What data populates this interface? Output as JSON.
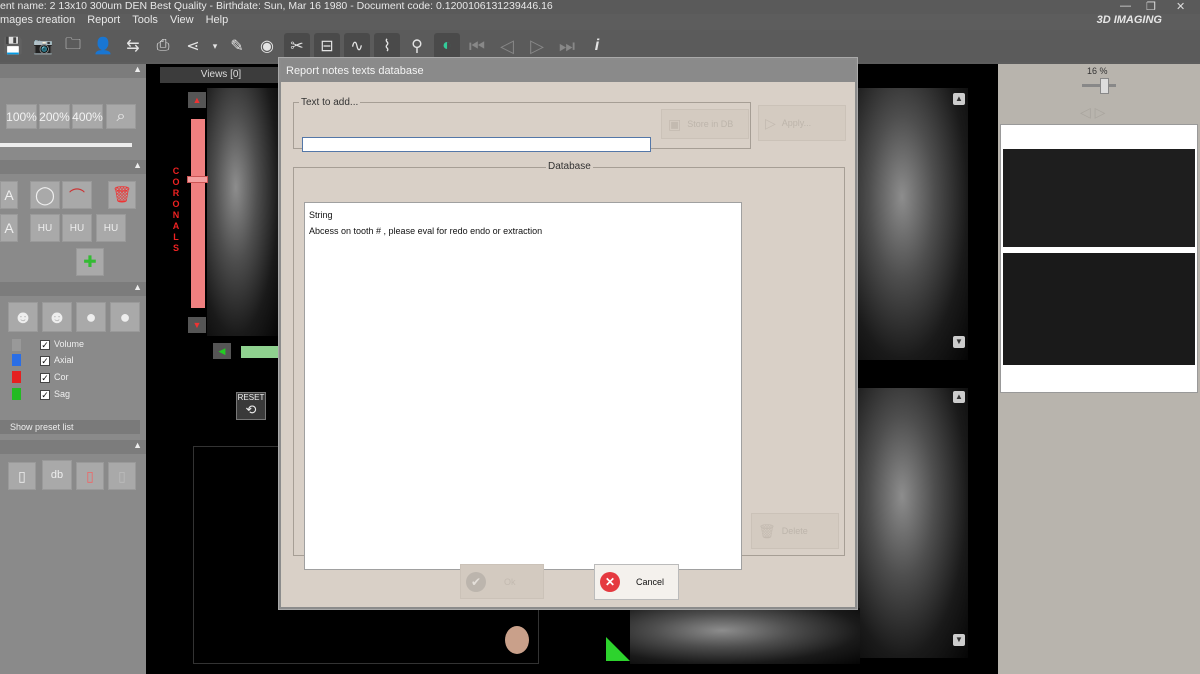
{
  "window": {
    "title": "ent name: 2 13x10 300um DEN Best Quality - Birthdate: Sun, Mar 16 1980 - Document code: 0.1200106131239446.16",
    "brand": "3D IMAGING"
  },
  "menu": [
    "mages creation",
    "Report",
    "Tools",
    "View",
    "Help"
  ],
  "left_panel": {
    "zoom_buttons": [
      "100%",
      "200%",
      "400%"
    ],
    "hu_labels": [
      "HU",
      "HU",
      "HU"
    ],
    "layers": [
      {
        "label": "Volume",
        "color": ""
      },
      {
        "label": "Axial",
        "color": "#2a6ee6"
      },
      {
        "label": "Cor",
        "color": "#e52020"
      },
      {
        "label": "Sag",
        "color": "#22bb22"
      }
    ],
    "show_preset": "Show preset list"
  },
  "viewer": {
    "views_tab": "Views [0]",
    "coronals_label": "CORONALS",
    "reset_label": "RESET"
  },
  "right_panel": {
    "zoom_percent": "16 %"
  },
  "dialog": {
    "title": "Report notes texts database",
    "text_to_add_label": "Text to add...",
    "text_input_value": "",
    "store_button": "Store in DB",
    "apply_button": "Apply...",
    "database_label": "Database",
    "list_header": "String",
    "list_items": [
      "Abcess on tooth #     , please eval for redo endo or extraction"
    ],
    "delete_button": "Delete",
    "ok_button": "Ok",
    "cancel_button": "Cancel"
  }
}
